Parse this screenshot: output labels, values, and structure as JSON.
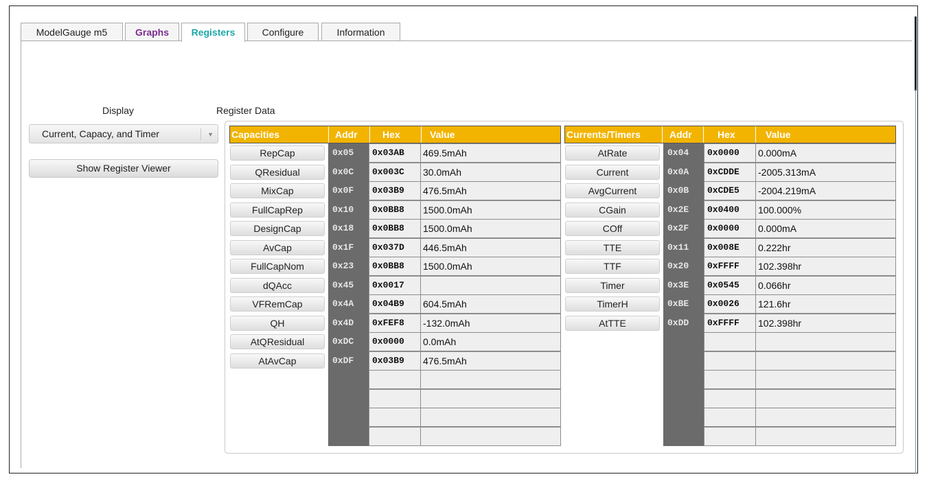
{
  "tabs": [
    {
      "label": "ModelGauge m5",
      "color": "#222222"
    },
    {
      "label": "Graphs",
      "color": "#7b2d8e"
    },
    {
      "label": "Registers",
      "color": "#1fa7a7"
    },
    {
      "label": "Configure",
      "color": "#222222"
    },
    {
      "label": "Information",
      "color": "#222222"
    }
  ],
  "display": {
    "label": "Display",
    "selected": "Current, Capacy, and Timer",
    "show_button": "Show Register Viewer"
  },
  "register_data_label": "Register Data",
  "capacities": {
    "headers": {
      "name": "Capacities",
      "addr": "Addr",
      "hex": "Hex",
      "value": "Value"
    },
    "rows": [
      {
        "name": "RepCap",
        "addr": "0x05",
        "hex": "0x03AB",
        "value": "469.5mAh"
      },
      {
        "name": "QResidual",
        "addr": "0x0C",
        "hex": "0x003C",
        "value": "30.0mAh"
      },
      {
        "name": "MixCap",
        "addr": "0x0F",
        "hex": "0x03B9",
        "value": "476.5mAh"
      },
      {
        "name": "FullCapRep",
        "addr": "0x10",
        "hex": "0x0BB8",
        "value": "1500.0mAh"
      },
      {
        "name": "DesignCap",
        "addr": "0x18",
        "hex": "0x0BB8",
        "value": "1500.0mAh"
      },
      {
        "name": "AvCap",
        "addr": "0x1F",
        "hex": "0x037D",
        "value": "446.5mAh"
      },
      {
        "name": "FullCapNom",
        "addr": "0x23",
        "hex": "0x0BB8",
        "value": "1500.0mAh"
      },
      {
        "name": "dQAcc",
        "addr": "0x45",
        "hex": "0x0017",
        "value": ""
      },
      {
        "name": "VFRemCap",
        "addr": "0x4A",
        "hex": "0x04B9",
        "value": "604.5mAh"
      },
      {
        "name": "QH",
        "addr": "0x4D",
        "hex": "0xFEF8",
        "value": "-132.0mAh"
      },
      {
        "name": "AtQResidual",
        "addr": "0xDC",
        "hex": "0x0000",
        "value": "0.0mAh"
      },
      {
        "name": "AtAvCap",
        "addr": "0xDF",
        "hex": "0x03B9",
        "value": "476.5mAh"
      }
    ]
  },
  "currents": {
    "headers": {
      "name": "Currents/Timers",
      "addr": "Addr",
      "hex": "Hex",
      "value": "Value"
    },
    "rows": [
      {
        "name": "AtRate",
        "addr": "0x04",
        "hex": "0x0000",
        "value": "0.000mA"
      },
      {
        "name": "Current",
        "addr": "0x0A",
        "hex": "0xCDDE",
        "value": "-2005.313mA"
      },
      {
        "name": "AvgCurrent",
        "addr": "0x0B",
        "hex": "0xCDE5",
        "value": "-2004.219mA"
      },
      {
        "name": "CGain",
        "addr": "0x2E",
        "hex": "0x0400",
        "value": "100.000%"
      },
      {
        "name": "COff",
        "addr": "0x2F",
        "hex": "0x0000",
        "value": "0.000mA"
      },
      {
        "name": "TTE",
        "addr": "0x11",
        "hex": "0x008E",
        "value": "0.222hr"
      },
      {
        "name": "TTF",
        "addr": "0x20",
        "hex": "0xFFFF",
        "value": "102.398hr"
      },
      {
        "name": "Timer",
        "addr": "0x3E",
        "hex": "0x0545",
        "value": "0.066hr"
      },
      {
        "name": "TimerH",
        "addr": "0xBE",
        "hex": "0x0026",
        "value": "121.6hr"
      },
      {
        "name": "AtTTE",
        "addr": "0xDD",
        "hex": "0xFFFF",
        "value": "102.398hr"
      }
    ]
  }
}
